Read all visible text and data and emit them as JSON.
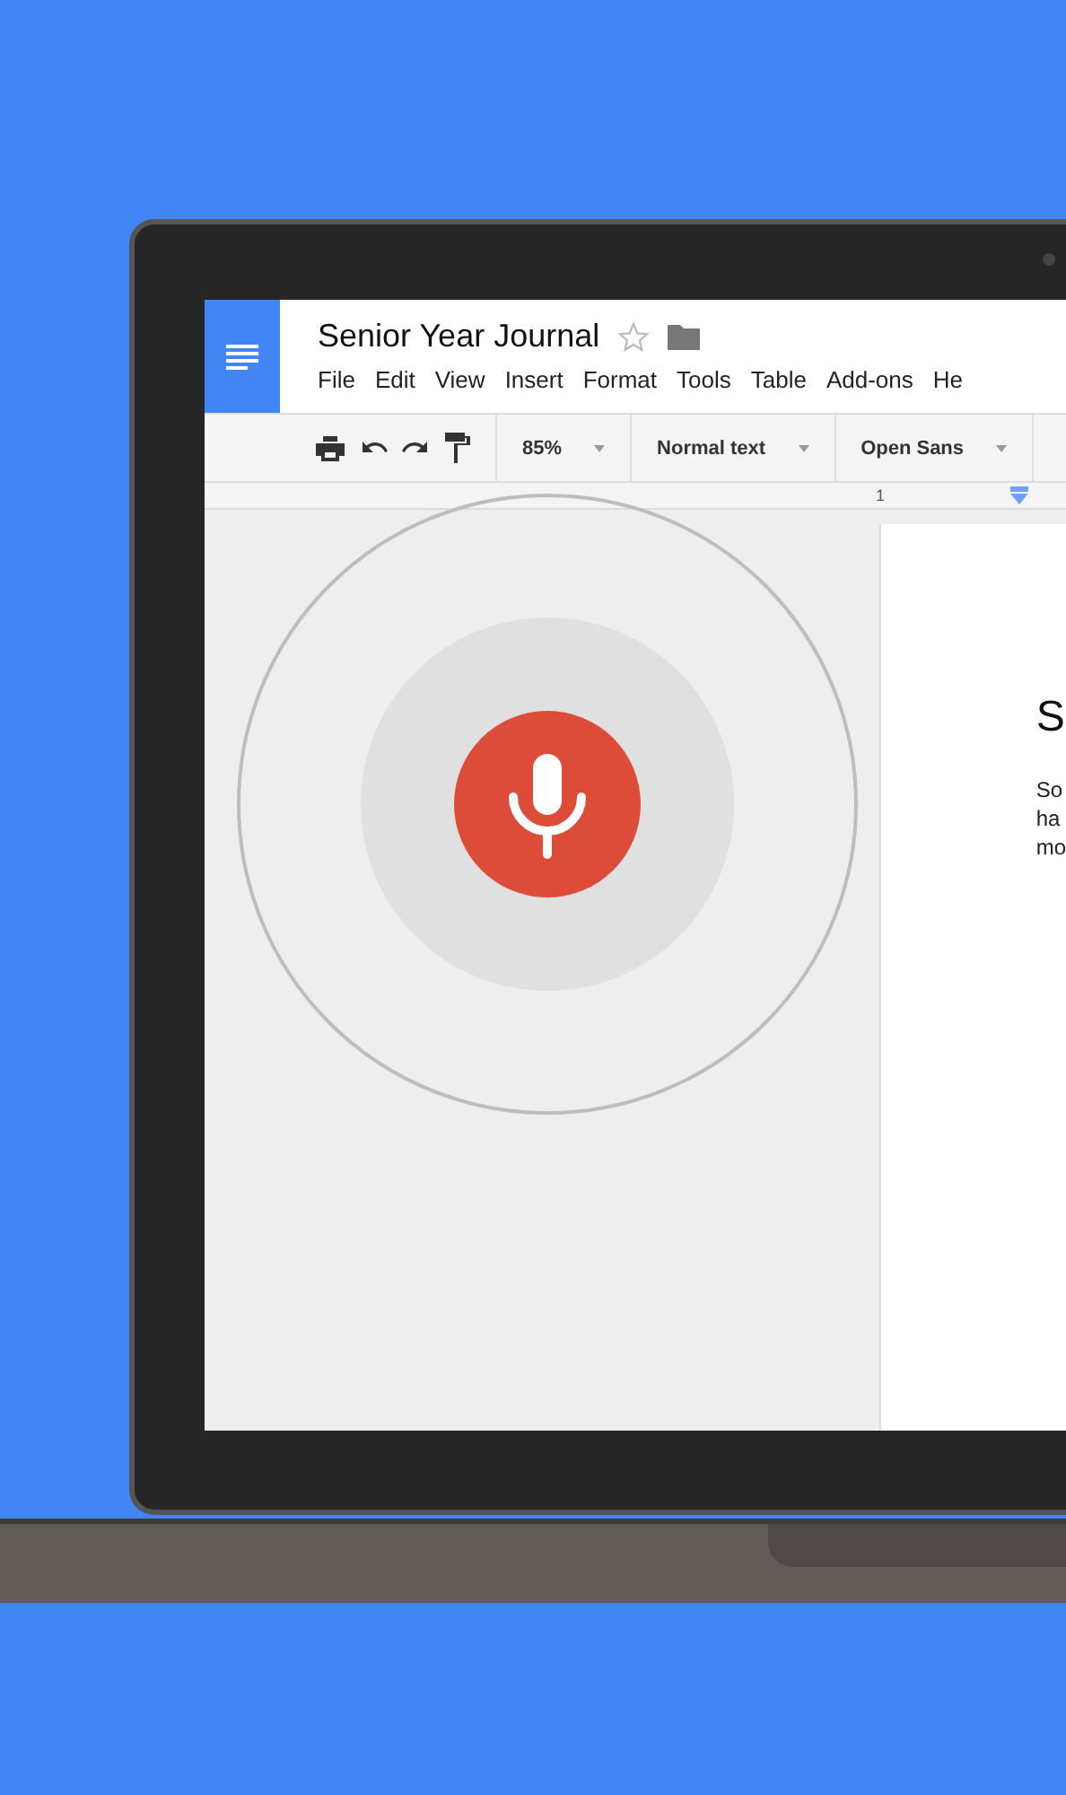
{
  "document": {
    "title": "Senior Year Journal",
    "starred": false
  },
  "menu": [
    "File",
    "Edit",
    "View",
    "Insert",
    "Format",
    "Tools",
    "Table",
    "Add-ons",
    "He"
  ],
  "toolbar": {
    "zoom": "85%",
    "style": "Normal text",
    "font": "Open Sans"
  },
  "ruler": {
    "mark": "1"
  },
  "page": {
    "heading": "S",
    "lines": [
      "So",
      "ha",
      "mo"
    ]
  }
}
